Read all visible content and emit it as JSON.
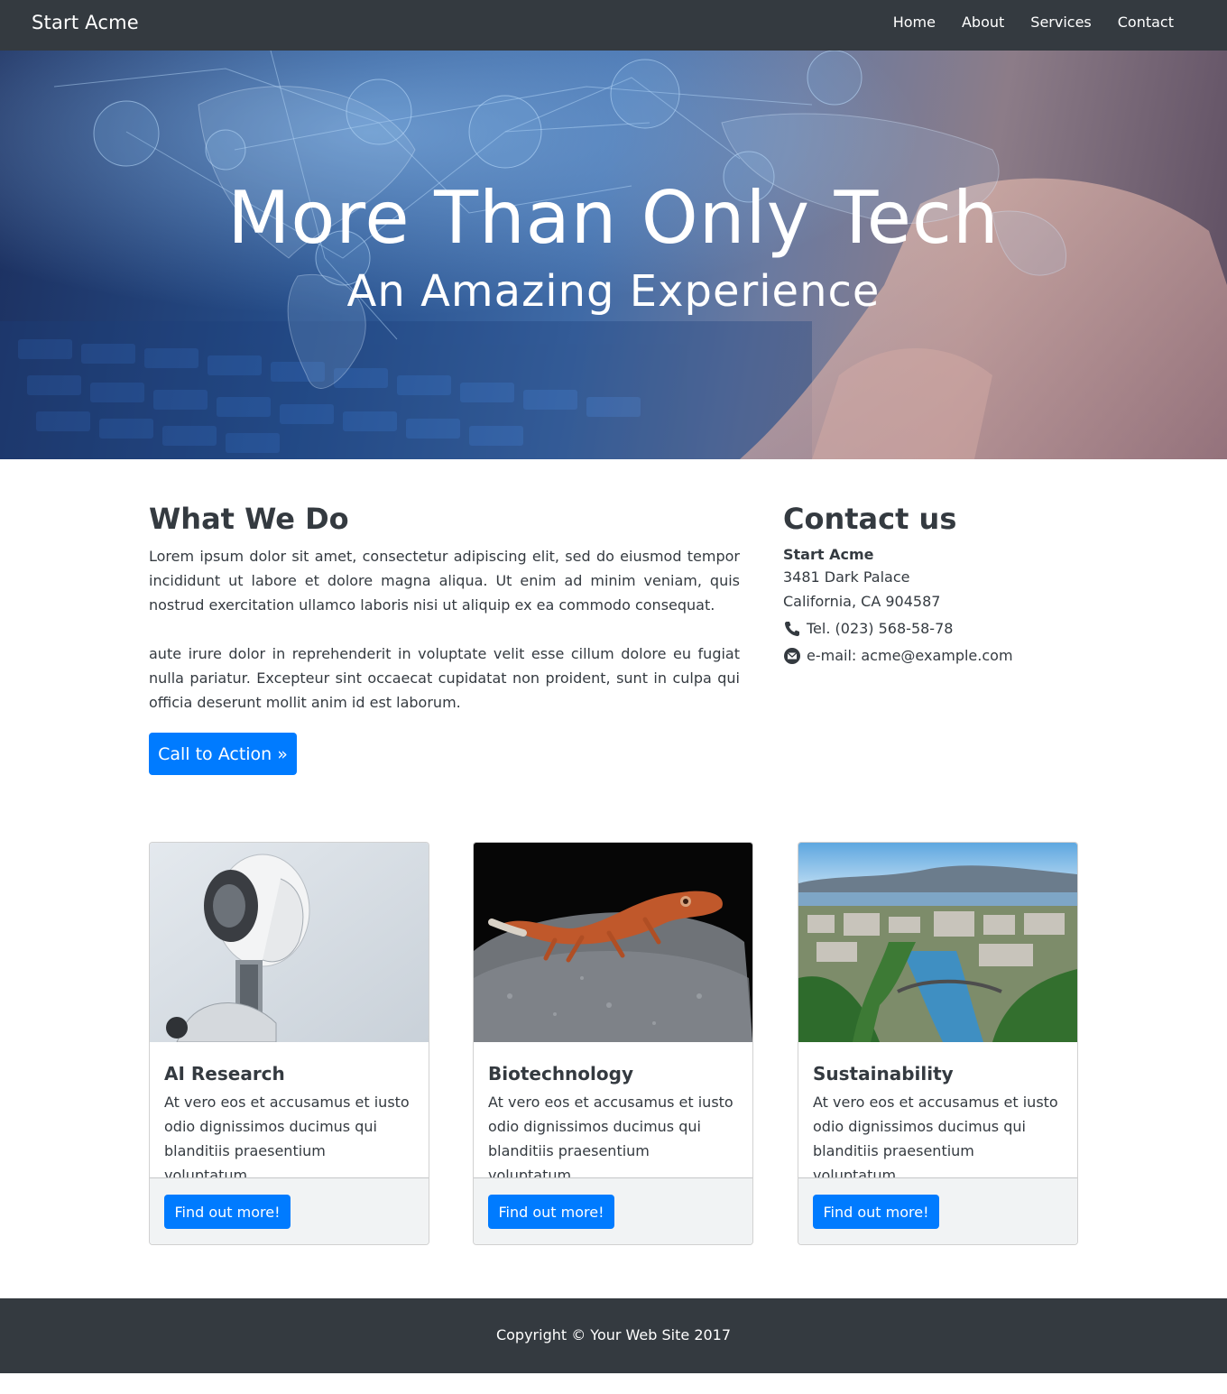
{
  "navbar": {
    "brand": "Start Acme",
    "links": [
      "Home",
      "About",
      "Services",
      "Contact"
    ]
  },
  "hero": {
    "title": "More Than Only Tech",
    "subtitle": "An Amazing Experience"
  },
  "what_we_do": {
    "heading": "What We Do",
    "paragraph1": "Lorem ipsum dolor sit amet, consectetur adipiscing elit, sed do eiusmod tempor incididunt ut labore et dolore magna aliqua. Ut enim ad minim veniam, quis nostrud exercitation ullamco laboris nisi ut aliquip ex ea commodo consequat.",
    "paragraph2": "aute irure dolor in reprehenderit in voluptate velit esse cillum dolore eu fugiat nulla pariatur. Excepteur sint occaecat cupidatat non proident, sunt in culpa qui officia deserunt mollit anim id est laborum.",
    "cta_label": "Call to Action »"
  },
  "contact": {
    "heading": "Contact us",
    "company": "Start Acme",
    "address1": "3481 Dark Palace",
    "address2": "California, CA 904587",
    "phone": "Tel. (023) 568-58-78",
    "email": "e-mail: acme@example.com"
  },
  "cards": [
    {
      "title": "AI Research",
      "text": "At vero eos et accusamus et iusto odio dignissimos ducimus qui blanditiis praesentium voluptatum.",
      "button": "Find out more!"
    },
    {
      "title": "Biotechnology",
      "text": "At vero eos et accusamus et iusto odio dignissimos ducimus qui blanditiis praesentium voluptatum.",
      "button": "Find out more!"
    },
    {
      "title": "Sustainability",
      "text": "At vero eos et accusamus et iusto odio dignissimos ducimus qui blanditiis praesentium voluptatum.",
      "button": "Find out more!"
    }
  ],
  "footer": {
    "copyright": "Copyright © Your Web Site 2017"
  },
  "colors": {
    "navbar": "#343a40",
    "primary": "#007bff",
    "card_footer": "#f1f3f4",
    "text": "#343a40"
  }
}
